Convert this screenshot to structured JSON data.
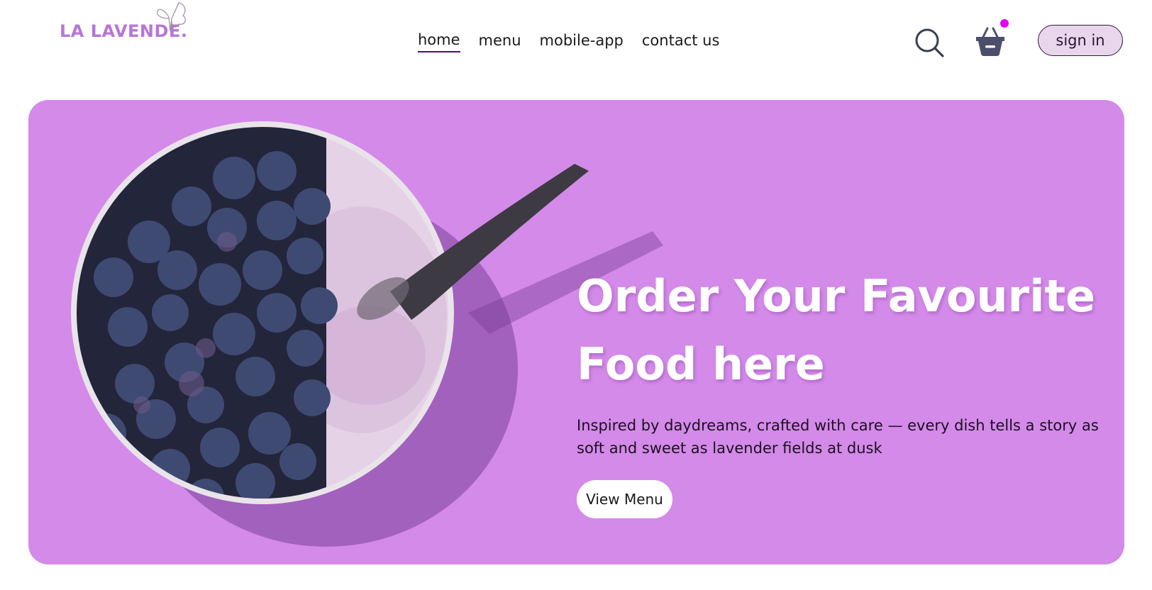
{
  "brand": {
    "logo_text": "LA LAVENDE.",
    "logo_color": "#b676d6"
  },
  "nav": {
    "items": [
      {
        "label": "home",
        "active": true
      },
      {
        "label": "menu",
        "active": false
      },
      {
        "label": "mobile-app",
        "active": false
      },
      {
        "label": "contact us",
        "active": false
      }
    ]
  },
  "header_actions": {
    "search_icon": "search-icon",
    "cart_icon": "basket-icon",
    "cart_has_items": true,
    "cart_dot_color": "#e400f2",
    "signin_label": "sign in"
  },
  "hero": {
    "title": "Order Your Favourite Food here",
    "subtitle": "Inspired by daydreams, crafted with care — every dish tells a story as soft and sweet as lavender fields at dusk",
    "cta_label": "View Menu",
    "background_color": "#d48ae9",
    "image_icon": "yogurt-blueberry-bowl-image"
  }
}
